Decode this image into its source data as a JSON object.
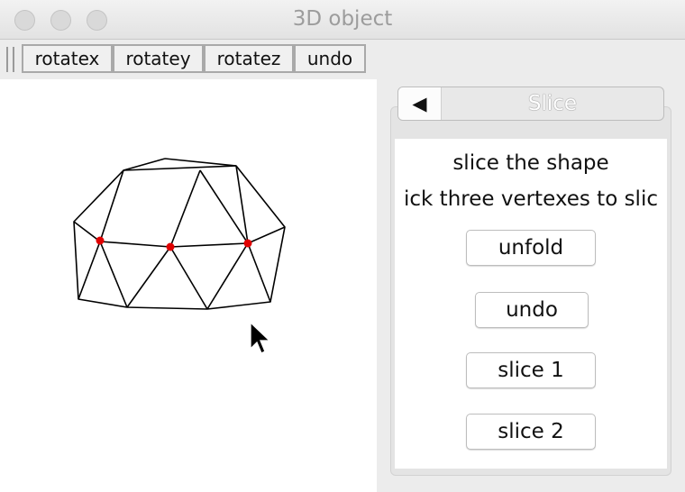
{
  "window": {
    "title": "3D object"
  },
  "toolbar": {
    "buttons": [
      "rotatex",
      "rotatey",
      "rotatez",
      "undo"
    ]
  },
  "slice_panel": {
    "back_glyph": "◀",
    "title": "Slice",
    "heading": "slice the shape",
    "instruction": "ick three vertexes to slic",
    "buttons": [
      "unfold",
      "undo",
      "slice 1",
      "slice 2"
    ]
  },
  "viewport": {
    "selected_vertex_color": "#e00000",
    "edge_color": "#000000"
  }
}
